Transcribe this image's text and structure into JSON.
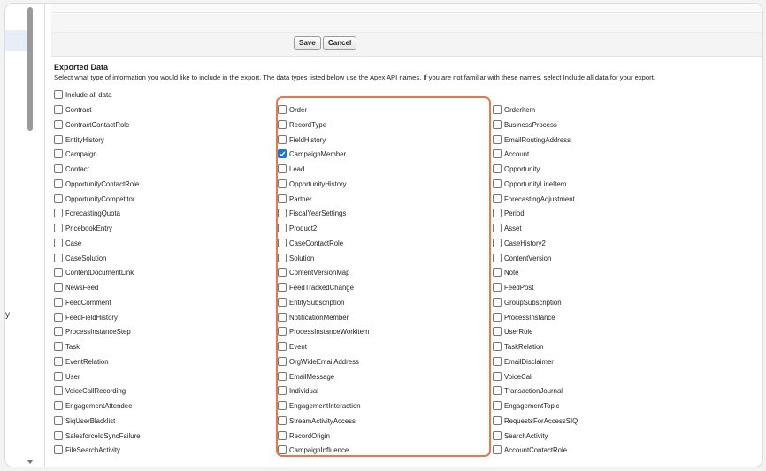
{
  "buttons": {
    "save": "Save",
    "cancel": "Cancel"
  },
  "left": {
    "letter": "y"
  },
  "section": {
    "title": "Exported Data",
    "description": "Select what type of information you would like to include in the export. The data types listed below use the Apex API names. If you are not familiar with these names, select Include all data for your export.",
    "include_all": {
      "label": "Include all data",
      "checked": false
    }
  },
  "columns": [
    {
      "items": [
        {
          "label": "Contract",
          "checked": false
        },
        {
          "label": "ContractContactRole",
          "checked": false
        },
        {
          "label": "EntityHistory",
          "checked": false
        },
        {
          "label": "Campaign",
          "checked": false
        },
        {
          "label": "Contact",
          "checked": false
        },
        {
          "label": "OpportunityContactRole",
          "checked": false
        },
        {
          "label": "OpportunityCompetitor",
          "checked": false
        },
        {
          "label": "ForecastingQuota",
          "checked": false
        },
        {
          "label": "PricebookEntry",
          "checked": false
        },
        {
          "label": "Case",
          "checked": false
        },
        {
          "label": "CaseSolution",
          "checked": false
        },
        {
          "label": "ContentDocumentLink",
          "checked": false
        },
        {
          "label": "NewsFeed",
          "checked": false
        },
        {
          "label": "FeedComment",
          "checked": false
        },
        {
          "label": "FeedFieldHistory",
          "checked": false
        },
        {
          "label": "ProcessInstanceStep",
          "checked": false
        },
        {
          "label": "Task",
          "checked": false
        },
        {
          "label": "EventRelation",
          "checked": false
        },
        {
          "label": "User",
          "checked": false
        },
        {
          "label": "VoiceCallRecording",
          "checked": false
        },
        {
          "label": "EngagementAttendee",
          "checked": false
        },
        {
          "label": "SiqUserBlacklist",
          "checked": false
        },
        {
          "label": "SalesforceIqSyncFailure",
          "checked": false
        },
        {
          "label": "FileSearchActivity",
          "checked": false
        }
      ]
    },
    {
      "items": [
        {
          "label": "Order",
          "checked": false
        },
        {
          "label": "RecordType",
          "checked": false
        },
        {
          "label": "FieldHistory",
          "checked": false
        },
        {
          "label": "CampaignMember",
          "checked": true
        },
        {
          "label": "Lead",
          "checked": false
        },
        {
          "label": "OpportunityHistory",
          "checked": false
        },
        {
          "label": "Partner",
          "checked": false
        },
        {
          "label": "FiscalYearSettings",
          "checked": false
        },
        {
          "label": "Product2",
          "checked": false
        },
        {
          "label": "CaseContactRole",
          "checked": false
        },
        {
          "label": "Solution",
          "checked": false
        },
        {
          "label": "ContentVersionMap",
          "checked": false
        },
        {
          "label": "FeedTrackedChange",
          "checked": false
        },
        {
          "label": "EntitySubscription",
          "checked": false
        },
        {
          "label": "NotificationMember",
          "checked": false
        },
        {
          "label": "ProcessInstanceWorkitem",
          "checked": false
        },
        {
          "label": "Event",
          "checked": false
        },
        {
          "label": "OrgWideEmailAddress",
          "checked": false
        },
        {
          "label": "EmailMessage",
          "checked": false
        },
        {
          "label": "Individual",
          "checked": false
        },
        {
          "label": "EngagementInteraction",
          "checked": false
        },
        {
          "label": "StreamActivityAccess",
          "checked": false
        },
        {
          "label": "RecordOrigin",
          "checked": false
        },
        {
          "label": "CampaignInfluence",
          "checked": false
        }
      ]
    },
    {
      "items": [
        {
          "label": "OrderItem",
          "checked": false
        },
        {
          "label": "BusinessProcess",
          "checked": false
        },
        {
          "label": "EmailRoutingAddress",
          "checked": false
        },
        {
          "label": "Account",
          "checked": false
        },
        {
          "label": "Opportunity",
          "checked": false
        },
        {
          "label": "OpportunityLineItem",
          "checked": false
        },
        {
          "label": "ForecastingAdjustment",
          "checked": false
        },
        {
          "label": "Period",
          "checked": false
        },
        {
          "label": "Asset",
          "checked": false
        },
        {
          "label": "CaseHistory2",
          "checked": false
        },
        {
          "label": "ContentVersion",
          "checked": false
        },
        {
          "label": "Note",
          "checked": false
        },
        {
          "label": "FeedPost",
          "checked": false
        },
        {
          "label": "GroupSubscription",
          "checked": false
        },
        {
          "label": "ProcessInstance",
          "checked": false
        },
        {
          "label": "UserRole",
          "checked": false
        },
        {
          "label": "TaskRelation",
          "checked": false
        },
        {
          "label": "EmailDisclaimer",
          "checked": false
        },
        {
          "label": "VoiceCall",
          "checked": false
        },
        {
          "label": "TransactionJournal",
          "checked": false
        },
        {
          "label": "EngagementTopic",
          "checked": false
        },
        {
          "label": "RequestsForAccessSIQ",
          "checked": false
        },
        {
          "label": "SearchActivity",
          "checked": false
        },
        {
          "label": "AccountContactRole",
          "checked": false
        }
      ]
    }
  ],
  "colors": {
    "highlight": "#e8794a",
    "checked": "#1a73e8"
  }
}
